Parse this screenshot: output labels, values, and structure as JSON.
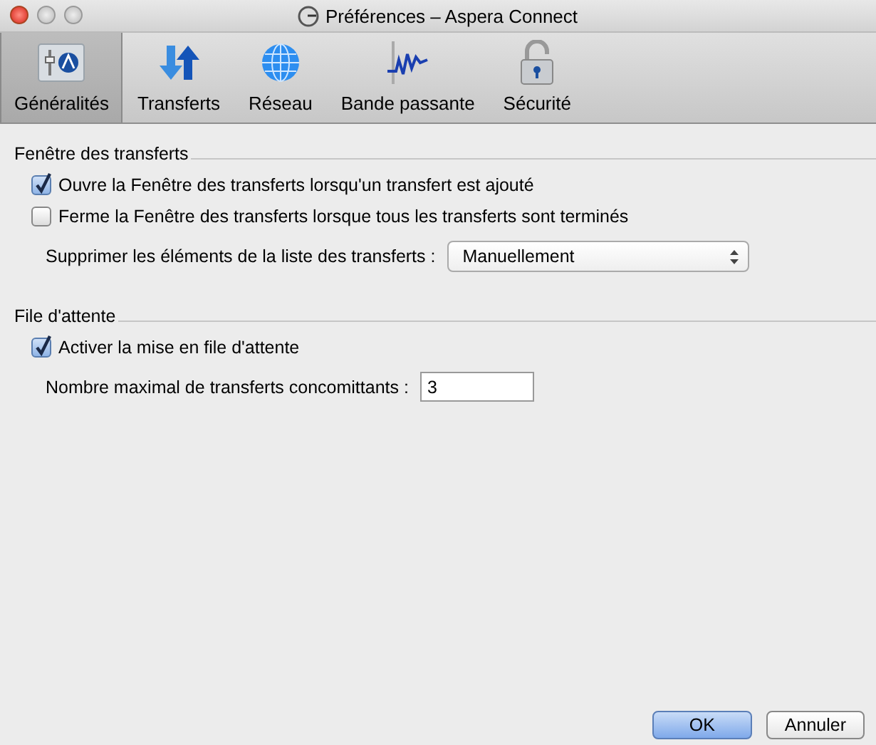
{
  "window": {
    "title": "Préférences – Aspera Connect"
  },
  "toolbar": [
    {
      "label": "Généralités",
      "kind": "general",
      "selected": true
    },
    {
      "label": "Transferts",
      "kind": "transfers",
      "selected": false
    },
    {
      "label": "Réseau",
      "kind": "network",
      "selected": false
    },
    {
      "label": "Bande passante",
      "kind": "bandwidth",
      "selected": false
    },
    {
      "label": "Sécurité",
      "kind": "security",
      "selected": false
    }
  ],
  "sections": [
    {
      "title": "Fenêtre des transferts",
      "rows": [
        {
          "kind": "checkbox",
          "label": "Ouvre la Fenêtre des transferts lorsqu'un transfert est ajouté",
          "checked": true
        },
        {
          "kind": "checkbox",
          "label": "Ferme la Fenêtre des transferts lorsque tous les transferts sont terminés",
          "checked": false
        },
        {
          "kind": "select",
          "label": "Supprimer les éléments de la liste des transferts :",
          "value": "Manuellement"
        }
      ]
    },
    {
      "title": "File d'attente",
      "rows": [
        {
          "kind": "checkbox",
          "label": "Activer la mise en file d'attente",
          "checked": true
        },
        {
          "kind": "number",
          "label": "Nombre maximal de transferts concomittants :",
          "value": "3"
        }
      ]
    }
  ],
  "buttons": [
    {
      "label": "OK",
      "kind": "default"
    },
    {
      "label": "Annuler",
      "kind": "normal"
    }
  ]
}
